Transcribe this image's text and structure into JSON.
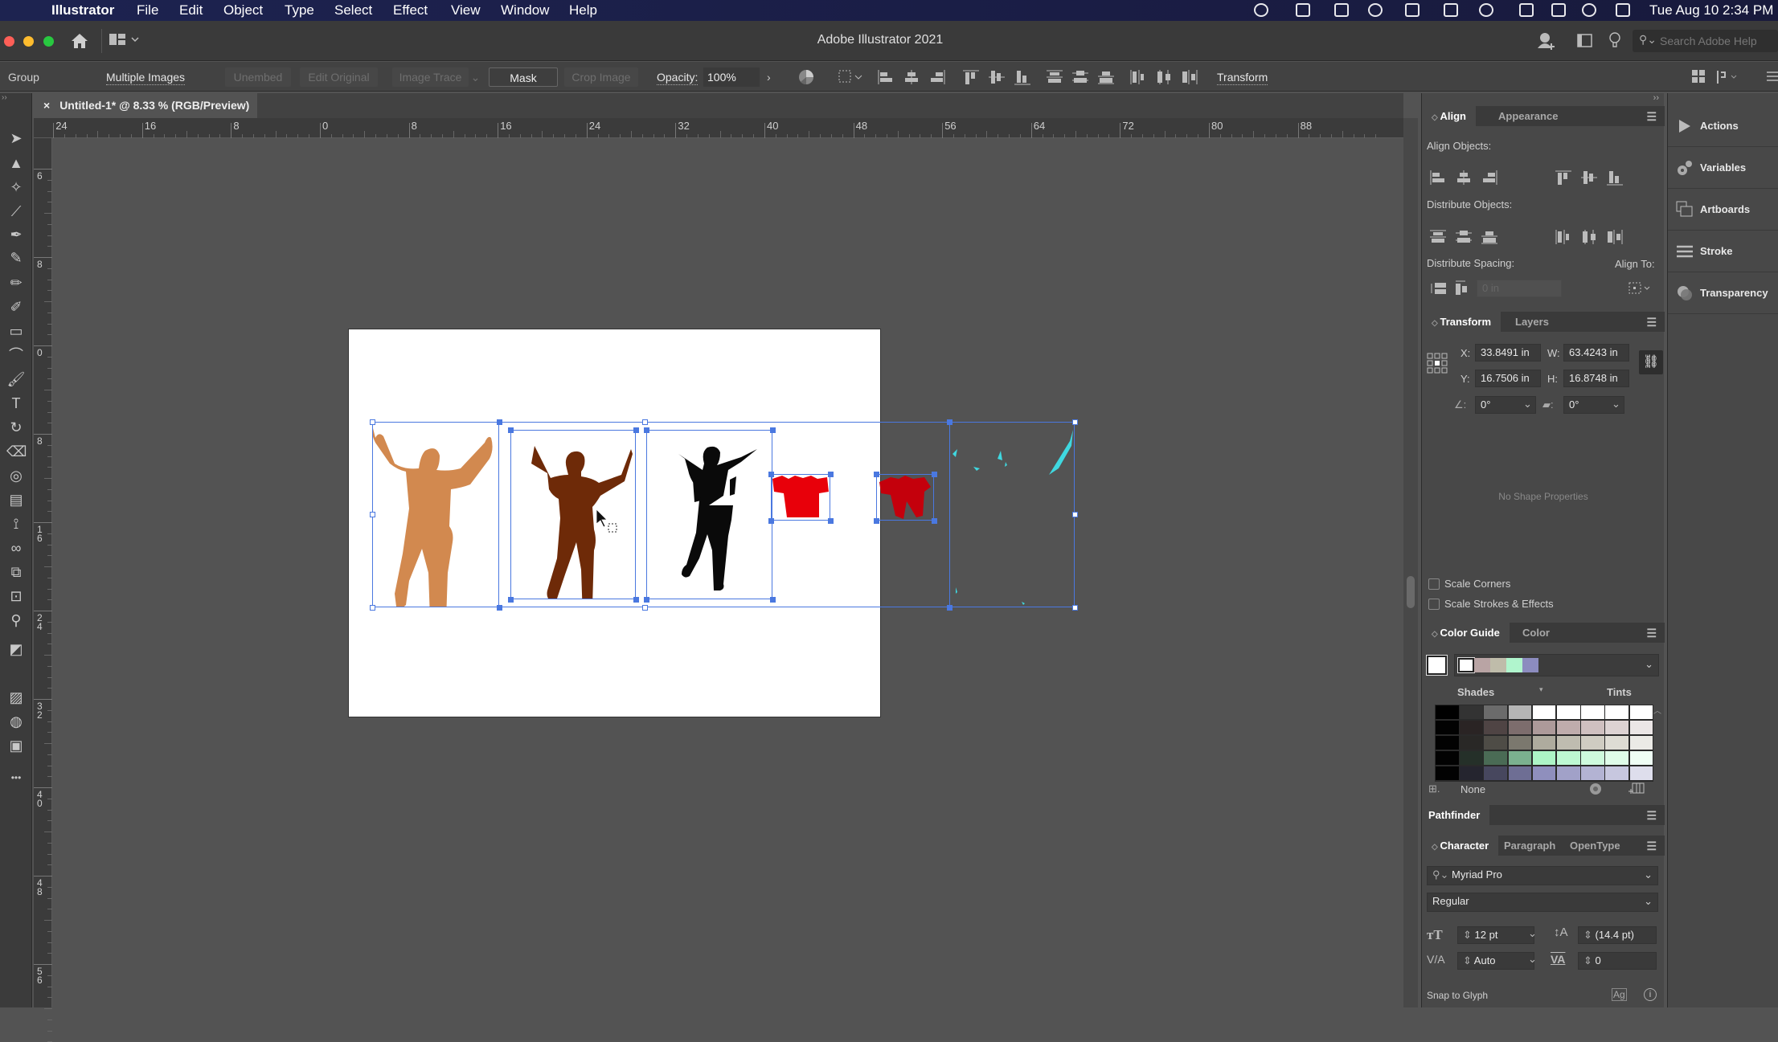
{
  "menubar": {
    "app": "Illustrator",
    "items": [
      "File",
      "Edit",
      "Object",
      "Type",
      "Select",
      "Effect",
      "View",
      "Window",
      "Help"
    ],
    "clock": "Tue Aug 10  2:34 PM",
    "status_icons": [
      "creative-cloud-icon",
      "sync-icon",
      "app-icon",
      "onepassword-icon",
      "malwarebytes-icon",
      "bluetooth-icon",
      "battery-icon",
      "wifi-icon",
      "spotlight-icon",
      "control-center-icon",
      "siri-icon"
    ]
  },
  "titlebar": {
    "title": "Adobe Illustrator 2021",
    "search_placeholder": "Search Adobe Help"
  },
  "control": {
    "selection_type": "Group",
    "multiple_images": "Multiple Images",
    "unembed": "Unembed",
    "edit_original": "Edit Original",
    "image_trace": "Image Trace",
    "mask": "Mask",
    "crop_image": "Crop Image",
    "opacity_label": "Opacity:",
    "opacity_value": "100%",
    "transform": "Transform"
  },
  "document": {
    "tab_close": "×",
    "tab_title": "Untitled-1* @ 8.33 % (RGB/Preview)"
  },
  "rulers": {
    "horizontal": [
      "24",
      "16",
      "8",
      "0",
      "8",
      "16",
      "24",
      "32",
      "40",
      "48",
      "56",
      "64",
      "72",
      "80",
      "88"
    ],
    "vertical": [
      "6",
      "8",
      "0",
      "8",
      "16",
      "24",
      "32",
      "40",
      "48",
      "56"
    ]
  },
  "align_panel": {
    "tabs": [
      "Align",
      "Appearance"
    ],
    "align_objects": "Align Objects:",
    "distribute_objects": "Distribute Objects:",
    "distribute_spacing": "Distribute Spacing:",
    "spacing_value": "0 in",
    "align_to": "Align To:"
  },
  "transform_panel": {
    "tabs": [
      "Transform",
      "Layers"
    ],
    "x_label": "X:",
    "x": "33.8491 in",
    "y_label": "Y:",
    "y": "16.7506 in",
    "w_label": "W:",
    "w": "63.4243 in",
    "h_label": "H:",
    "h": "16.8748 in",
    "rotate": "0°",
    "shear": "0°",
    "no_shape": "No Shape Properties",
    "scale_corners": "Scale Corners",
    "scale_strokes": "Scale Strokes & Effects"
  },
  "color_guide": {
    "tabs": [
      "Color Guide",
      "Color"
    ],
    "strip": [
      "#ffffff",
      "#b9a4a4",
      "#bfbcaa",
      "#b0f5cd",
      "#8c8cbf"
    ],
    "shades": "Shades",
    "tints": "Tints",
    "none": "None",
    "grid": [
      [
        "#000000",
        "#333333",
        "#6b6b6b",
        "#b5b5b5",
        "#ffffff",
        "#ffffff",
        "#ffffff",
        "#ffffff",
        "#ffffff"
      ],
      [
        "#020202",
        "#2a2424",
        "#4f4444",
        "#7d6d6d",
        "#ad9a9a",
        "#bfacac",
        "#cfc0c0",
        "#ddd3d3",
        "#ebe6e6"
      ],
      [
        "#020202",
        "#292826",
        "#4e4c46",
        "#7b786e",
        "#aeab9e",
        "#bfbcb0",
        "#cfccc2",
        "#dedcd4",
        "#ebeae6"
      ],
      [
        "#020202",
        "#253029",
        "#4a6b55",
        "#7bb18f",
        "#adf5c6",
        "#bdf8d2",
        "#cefadd",
        "#dffce9",
        "#effef4"
      ],
      [
        "#020202",
        "#25252f",
        "#47475e",
        "#6e6e94",
        "#8f8fbd",
        "#a1a1c8",
        "#b3b3d3",
        "#c7c7df",
        "#dedeec"
      ]
    ]
  },
  "pathfinder": {
    "title": "Pathfinder"
  },
  "character_panel": {
    "tabs": [
      "Character",
      "Paragraph",
      "OpenType"
    ],
    "font": "Myriad Pro",
    "style": "Regular",
    "size": "12 pt",
    "leading": "(14.4 pt)",
    "kerning": "Auto",
    "tracking": "0",
    "snap": "Snap to Glyph"
  },
  "dock": {
    "items": [
      {
        "label": "Actions",
        "icon": "play-icon"
      },
      {
        "label": "Variables",
        "icon": "gears-icon"
      },
      {
        "label": "Artboards",
        "icon": "artboards-icon"
      },
      {
        "label": "Stroke",
        "icon": "stroke-icon"
      },
      {
        "label": "Transparency",
        "icon": "transparency-icon"
      }
    ]
  },
  "artwork": {
    "colors": {
      "selection": "#4a78e0",
      "orange": "#d2894f",
      "brown": "#6e2a08",
      "black": "#0a0a0a",
      "red": "#e8000a",
      "dark_red": "#c4000c",
      "cyan": "#3fd8e0"
    }
  }
}
